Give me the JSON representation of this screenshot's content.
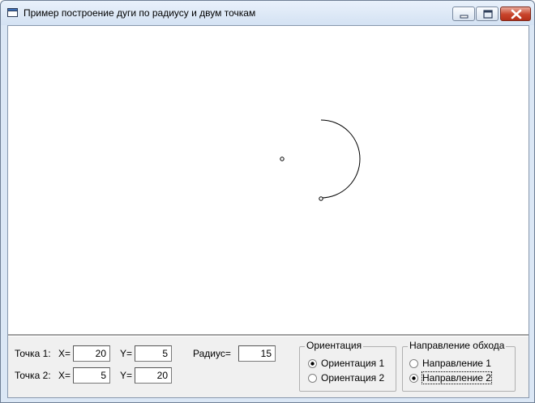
{
  "window": {
    "title": "Пример построение дуги по радиусу и двум точкам"
  },
  "point1": {
    "label": "Точка 1:",
    "x_label": "X=",
    "x_value": "20",
    "y_label": "Y=",
    "y_value": "5"
  },
  "point2": {
    "label": "Точка 2:",
    "x_label": "X=",
    "x_value": "5",
    "y_label": "Y=",
    "y_value": "20"
  },
  "radius": {
    "label": "Радиус=",
    "value": "15"
  },
  "orientation": {
    "title": "Ориентация",
    "options": [
      "Ориентация 1",
      "Ориентация 2"
    ],
    "selected": 0
  },
  "direction": {
    "title": "Направление обхода",
    "options": [
      "Направление 1",
      "Направление 2"
    ],
    "selected": 1
  },
  "colors": {
    "titlebar": "#d4e2f3",
    "close_button": "#c8442b",
    "canvas": "#ffffff",
    "panel": "#f0f0f0"
  }
}
